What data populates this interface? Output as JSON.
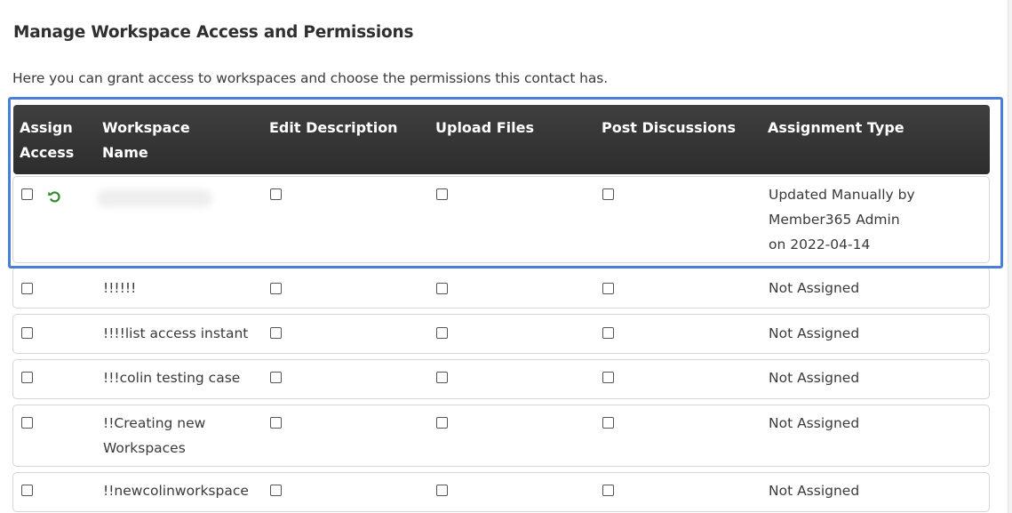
{
  "page": {
    "title": "Manage Workspace Access and Permissions",
    "subtitle": "Here you can grant access to workspaces and choose the permissions this contact has."
  },
  "table": {
    "headers": {
      "assign_access": "Assign Access",
      "workspace_name": "Workspace Name",
      "edit_description": "Edit Description",
      "upload_files": "Upload Files",
      "post_discussions": "Post Discussions",
      "assignment_type": "Assignment Type"
    },
    "rows": [
      {
        "workspace": "",
        "assignment": [
          "Updated Manually by",
          "Member365 Admin",
          "on 2022-04-14"
        ],
        "has_undo_icon": true,
        "name_blurred": true
      },
      {
        "workspace": [
          "!!!!!!"
        ],
        "assignment": [
          "Not Assigned"
        ]
      },
      {
        "workspace": [
          "!!!!list access instant"
        ],
        "assignment": [
          "Not Assigned"
        ]
      },
      {
        "workspace": [
          "!!!colin testing case"
        ],
        "assignment": [
          "Not Assigned"
        ]
      },
      {
        "workspace": [
          "!!Creating new",
          "Workspaces"
        ],
        "assignment": [
          "Not Assigned"
        ]
      },
      {
        "workspace": [
          "!!newcolinworkspace"
        ],
        "assignment": [
          "Not Assigned"
        ]
      }
    ]
  },
  "colors": {
    "header_bg": "#333333",
    "highlight": "#4a7fd9",
    "undo_icon": "#2e8b2e"
  },
  "icons": {
    "undo": "undo-arrow-icon"
  }
}
